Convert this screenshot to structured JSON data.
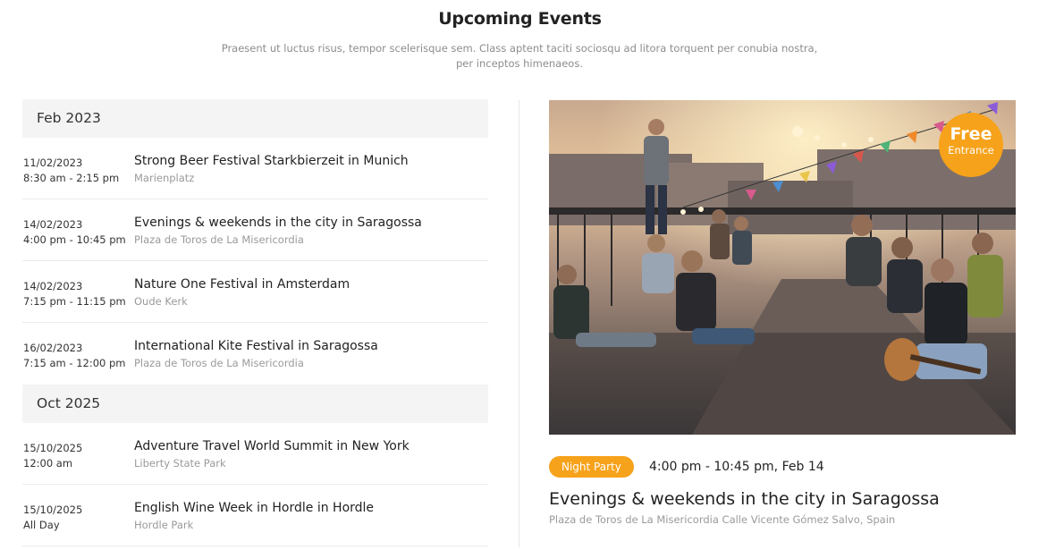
{
  "header": {
    "title": "Upcoming Events",
    "subtitle": "Prаesent ut luctus risus, tempor scelerisque sem. Class aptent taciti sociosqu ad litora torquent per conubia nostra, per inceptos himenaeos."
  },
  "groups": [
    {
      "month": "Feb 2023",
      "events": [
        {
          "date": "11/02/2023",
          "time": "8:30 am - 2:15 pm",
          "name": "Strong Beer Festival Starkbierzeit in Munich",
          "location": "Marienplatz"
        },
        {
          "date": "14/02/2023",
          "time": "4:00 pm - 10:45 pm",
          "name": "Evenings & weekends in the city in Saragossa",
          "location": "Plaza de Toros de La Misericordia"
        },
        {
          "date": "14/02/2023",
          "time": "7:15 pm - 11:15 pm",
          "name": "Nature One Festival in Amsterdam",
          "location": "Oude Kerk"
        },
        {
          "date": "16/02/2023",
          "time": "7:15 am - 12:00 pm",
          "name": "International Kite Festival in Saragossa",
          "location": "Plaza de Toros de La Misericordia"
        }
      ]
    },
    {
      "month": "Oct 2025",
      "events": [
        {
          "date": "15/10/2025",
          "time": "12:00 am",
          "name": "Adventure Travel World Summit in New York",
          "location": "Liberty State Park"
        },
        {
          "date": "15/10/2025",
          "time": "All Day",
          "name": "English Wine Week in Hordle in Hordle",
          "location": "Hordle Park"
        }
      ]
    }
  ],
  "featured": {
    "badge_big": "Free",
    "badge_small": "Entrance",
    "category": "Night Party",
    "datetime": "4:00 pm - 10:45 pm, Feb 14",
    "name": "Evenings & weekends in the city in Saragossa",
    "location": "Plaza de Toros de La Misericordia Calle Vicente Gómez Salvo, Spain"
  },
  "colors": {
    "accent": "#f7a21b",
    "month_bg": "#f4f4f4",
    "muted_text": "#9a9a9a"
  }
}
